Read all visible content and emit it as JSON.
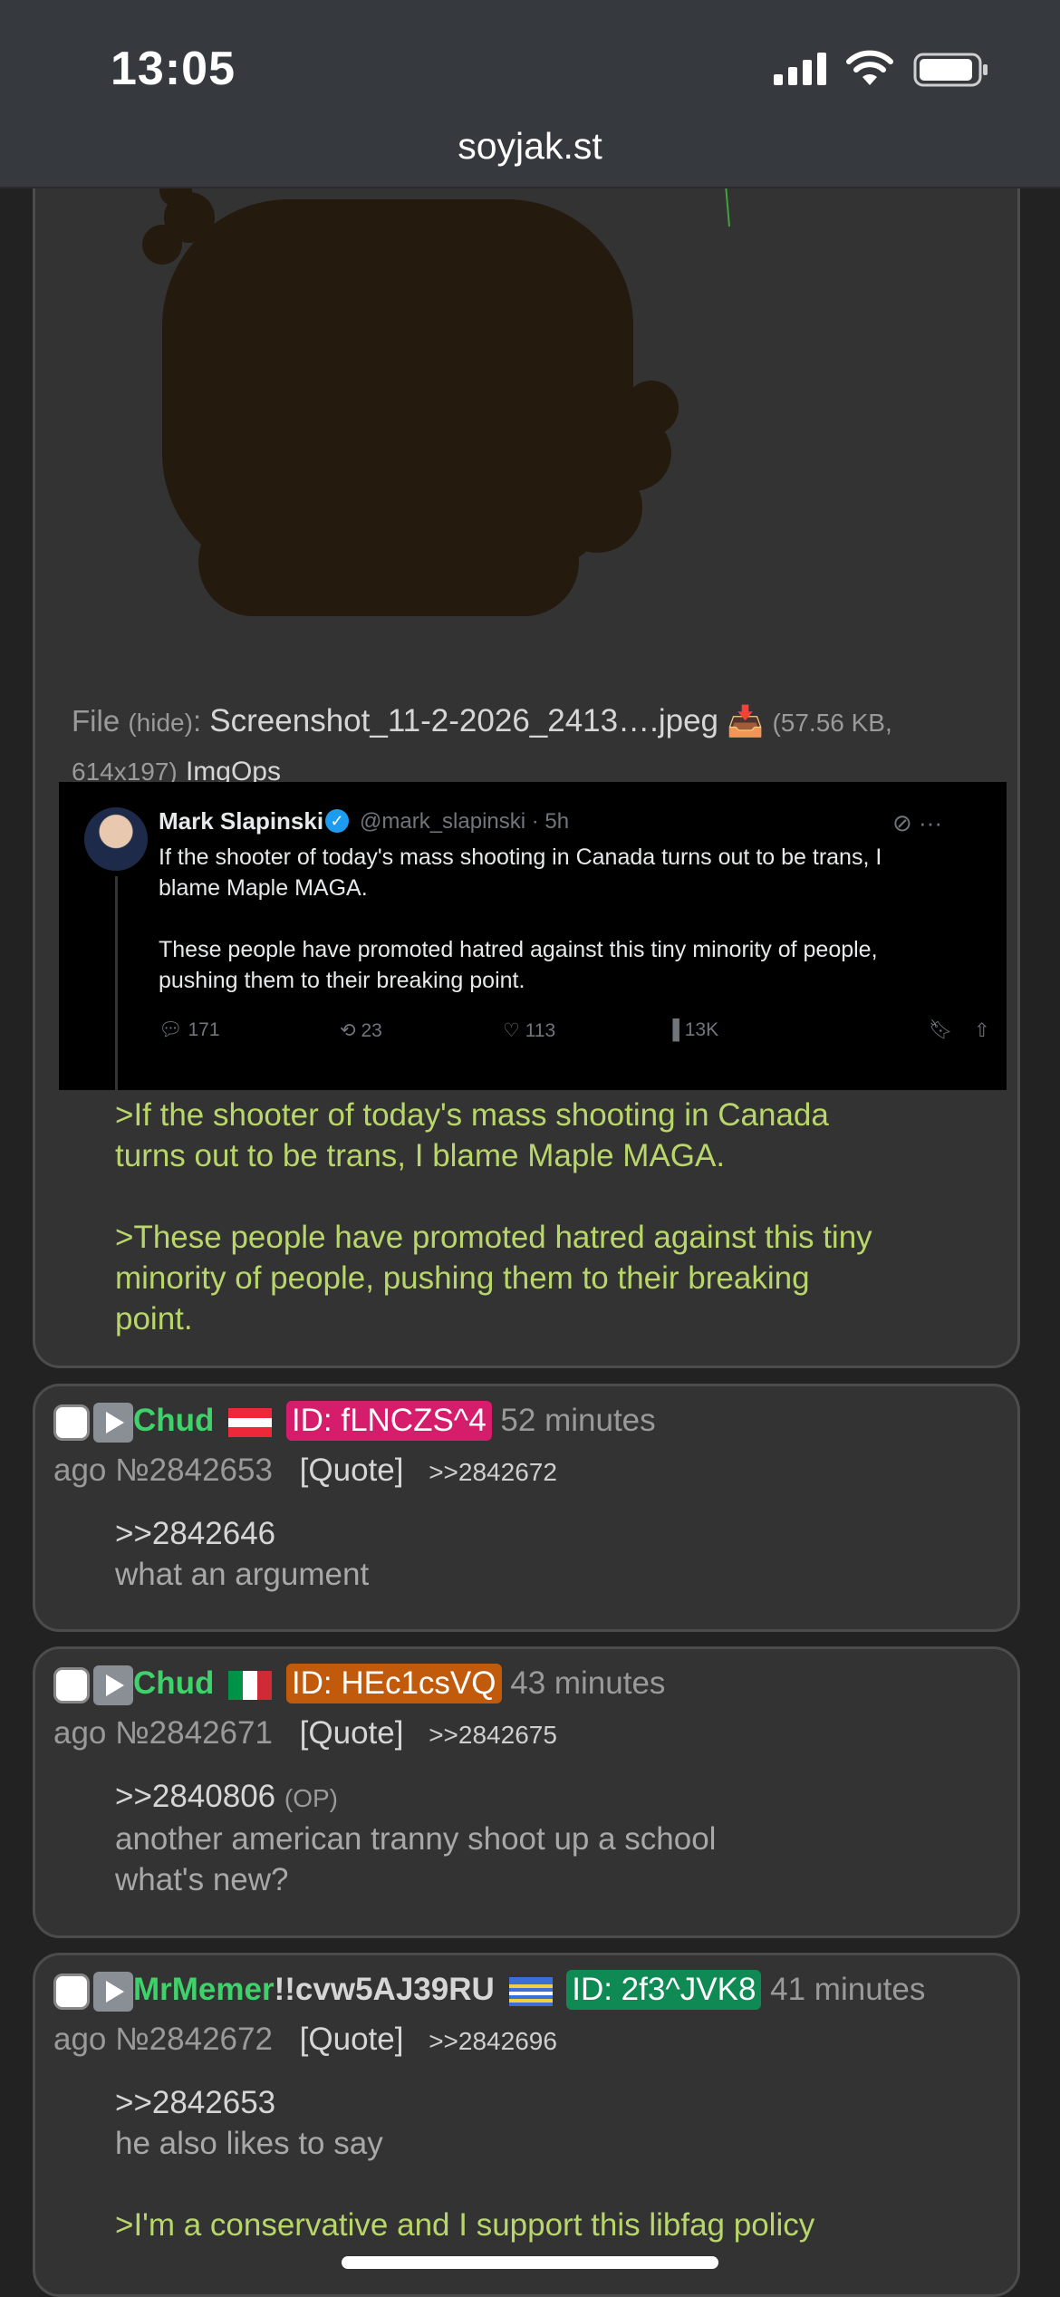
{
  "status_bar": {
    "time": "13:05"
  },
  "browser": {
    "url": "soyjak.st"
  },
  "post1": {
    "file_label": "File",
    "hide_label": "(hide)",
    "file_name": "Screenshot_11-2-2026_2413….jpeg",
    "file_meta": "(57.56 KB, 614x197)",
    "imgops": "ImgOps",
    "tweet": {
      "name": "Mark Slapinski",
      "handle": "@mark_slapinski · 5h",
      "line1": "If the shooter of today's mass shooting in Canada turns out to be trans, I",
      "line2": "blame Maple MAGA.",
      "line3": "These people have promoted hatred against this tiny minority of people,",
      "line4": "pushing them to their breaking point.",
      "replies": "171",
      "retweets": "23",
      "likes": "113",
      "views": "13K"
    },
    "green1a": ">If the shooter of today's mass shooting in Canada",
    "green1b": "turns out to be trans, I blame Maple MAGA.",
    "green2a": ">These people have promoted hatred against this tiny",
    "green2b": "minority of people, pushing them to their breaking",
    "green2c": "point."
  },
  "post2": {
    "name": "Chud",
    "id": "ID: fLNCZS^4",
    "id_color": "#d61d6b",
    "time_a": " 52 minutes",
    "time_b": "ago ",
    "number": "№2842653",
    "quote": "[Quote]",
    "backlink": ">>2842672",
    "reply_to": ">>2842646",
    "text1": "what an argument"
  },
  "post3": {
    "name": "Chud",
    "id": "ID: HEc1csVQ",
    "id_color": "#c25a0c",
    "time_a": " 43 minutes",
    "time_b": "ago ",
    "number": "№2842671",
    "quote": "[Quote]",
    "backlink": ">>2842675",
    "reply_to": ">>2840806",
    "op": "(OP)",
    "text1": "another american tranny shoot up a school",
    "text2": "what's new?"
  },
  "post4": {
    "name": "MrMemer",
    "trip": "!!cvw5AJ39RU",
    "id": "ID: 2f3^JVK8",
    "id_color": "#0f8a55",
    "time_a": " 41 minutes",
    "time_b": "ago ",
    "number": "№2842672",
    "quote": "[Quote]",
    "backlink": ">>2842696",
    "reply_to": ">>2842653",
    "text1": "he also likes to say",
    "green1": ">I'm a conservative and I support this libfag policy"
  }
}
